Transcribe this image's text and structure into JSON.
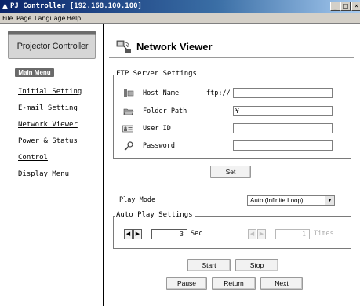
{
  "window": {
    "title": "PJ Controller [192.168.100.100]",
    "app_icon": "projector-icon",
    "controls": [
      "minimize-icon",
      "maximize-icon",
      "close-icon"
    ]
  },
  "menubar": {
    "items": [
      {
        "label": "File",
        "mnemonic": "F"
      },
      {
        "label": "Page",
        "mnemonic": "P"
      },
      {
        "label": "Language",
        "mnemonic": "L"
      },
      {
        "label": "Help",
        "mnemonic": "H"
      }
    ]
  },
  "sidebar": {
    "logo_text": "Projector Controller",
    "main_menu_label": "Main Menu",
    "links": [
      {
        "label": "Initial Setting"
      },
      {
        "label": "E-mail Setting"
      },
      {
        "label": "Network Viewer"
      },
      {
        "label": "Power & Status"
      },
      {
        "label": "Control"
      },
      {
        "label": "Display Menu"
      }
    ]
  },
  "page": {
    "title": "Network Viewer",
    "title_icon": "network-viewer-icon"
  },
  "ftp": {
    "legend": "FTP Server Settings",
    "host_label": "Host Name",
    "host_prefix": "ftp://",
    "host_value": "",
    "folder_label": "Folder Path",
    "folder_value": "¥",
    "user_label": "User ID",
    "user_value": "",
    "password_label": "Password",
    "password_value": "",
    "set_label": "Set",
    "icons": [
      "host-icon",
      "folder-icon",
      "user-id-icon",
      "password-key-icon"
    ]
  },
  "play": {
    "mode_label": "Play Mode",
    "mode_value": "Auto (Infinite Loop)",
    "auto_legend": "Auto Play Settings",
    "interval_value": "3",
    "interval_unit": "Sec",
    "times_value": "1",
    "times_unit": "Times",
    "times_disabled": true
  },
  "controls": {
    "start_label": "Start",
    "stop_label": "Stop",
    "pause_label": "Pause",
    "return_label": "Return",
    "next_label": "Next"
  },
  "colors": {
    "titlebar_start": "#0a246a",
    "titlebar_end": "#a6caf0",
    "chrome": "#d4d0c8",
    "badge": "#6a6a6a"
  }
}
